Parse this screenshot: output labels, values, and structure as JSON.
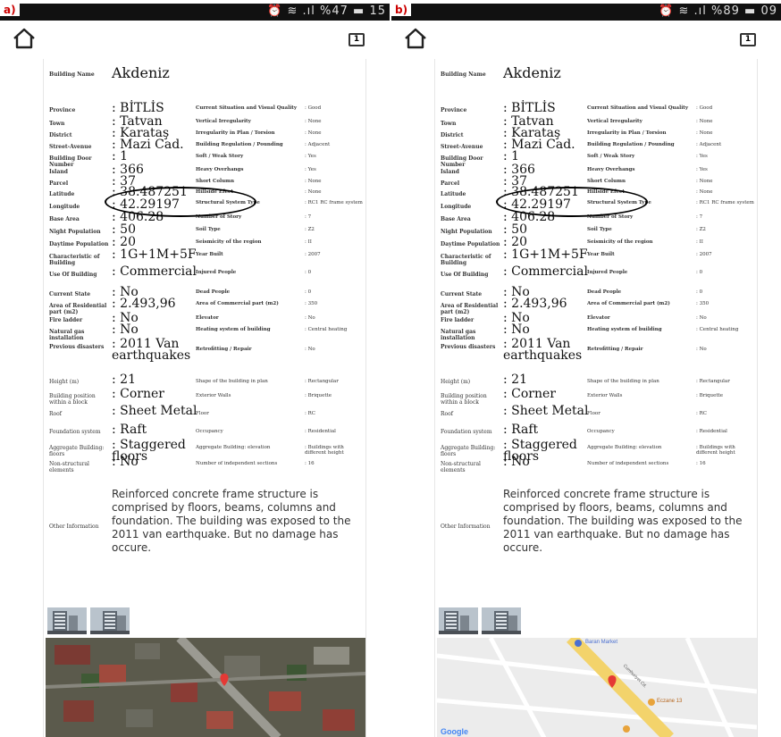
{
  "panels": [
    {
      "label": "a)",
      "status": "⏰ ≋ .ıl %47 ▬ 15",
      "tabs_count": "1",
      "building_name_label": "Building Name",
      "building_name": "Akdeniz",
      "left_rows": [
        {
          "label": "Province",
          "value": ": BİTLİS"
        },
        {
          "label": "Town",
          "value": ": Tatvan"
        },
        {
          "label": "District",
          "value": ": Karataş"
        },
        {
          "label": "Street-Avenue",
          "value": ": Mazi Cad."
        },
        {
          "label": "Building Door Number",
          "value": ": 1"
        },
        {
          "label": "Island",
          "value": ": 366"
        },
        {
          "label": "Parcel",
          "value": ": 37"
        },
        {
          "label": "Latitude",
          "value": ": 38.487251"
        },
        {
          "label": "Longitude",
          "value": ": 42.29197"
        },
        {
          "label": "Base Area",
          "value": ": 406.28"
        },
        {
          "label": "Night Population",
          "value": ": 50"
        },
        {
          "label": "Daytime Population",
          "value": ": 20"
        },
        {
          "label": "Characteristic of Building",
          "value": ": 1G+1M+5F"
        },
        {
          "label": "Use Of Building",
          "value": ": Commercial"
        },
        {
          "label": "Current State",
          "value": ": No"
        },
        {
          "label": "Area of Residential part (m2)",
          "value": ": 2.493,96"
        },
        {
          "label": "Fire ladder",
          "value": ": No"
        },
        {
          "label": "Natural gas installation",
          "value": ": No"
        },
        {
          "label": "Previous disasters",
          "value": ": 2011 Van earthquakes"
        }
      ],
      "right_rows": [
        {
          "label": "Current Situation and Visual Quality",
          "value": ": Good"
        },
        {
          "label": "Vertical Irregularity",
          "value": ": None"
        },
        {
          "label": "Irregularity in Plan / Torsion",
          "value": ": None"
        },
        {
          "label": "Building Regulation / Pounding",
          "value": ": Adjacent"
        },
        {
          "label": "Soft / Weak Story",
          "value": ": Yes"
        },
        {
          "label": "Heavy Overhangs",
          "value": ": Yes"
        },
        {
          "label": "Short Column",
          "value": ": None"
        },
        {
          "label": "Hillside Efect",
          "value": ": None"
        },
        {
          "label": "Structural System Type",
          "value": ": RC1 RC frame system"
        },
        {
          "label": "Number of Story",
          "value": ": 7"
        },
        {
          "label": "Soil Type",
          "value": ": Z2"
        },
        {
          "label": "Seismicity of the region",
          "value": ": II"
        },
        {
          "label": "Year Built",
          "value": ": 2007"
        },
        {
          "label": "Injured People",
          "value": ": 0"
        },
        {
          "label": "Dead People",
          "value": ": 0"
        },
        {
          "label": "Area of Commercial part (m2)",
          "value": ": 350"
        },
        {
          "label": "Elevator",
          "value": ": No"
        },
        {
          "label": "Heating system of building",
          "value": ": Central heating"
        },
        {
          "label": "Retrofitting / Repair",
          "value": ": No"
        }
      ],
      "lower_rows": [
        {
          "label": "Height (m)",
          "value": ": 21",
          "label2": "Shape of the building in plan",
          "value2": ": Rectangular"
        },
        {
          "label": "Building position within a block",
          "value": ": Corner",
          "label2": "Exterior Walls",
          "value2": ": Briquette"
        },
        {
          "label": "Roof",
          "value": ": Sheet Metal",
          "label2": "Floor",
          "value2": ": RC"
        },
        {
          "label": "Foundation system",
          "value": ": Raft",
          "label2": "Occupancy",
          "value2": ": Residential"
        },
        {
          "label": "Aggregate Building: floors",
          "value": ": Staggered floors",
          "label2": "Aggregate Building: elevation",
          "value2": ": Buildings with different height"
        },
        {
          "label": "Non-structural elements",
          "value": ": No",
          "label2": "Number of independent sections",
          "value2": ": 16"
        }
      ],
      "other_info_label": "Other Information",
      "other_info": "Reinforced concrete frame structure is comprised by floors, beams, columns and foundation. The building was exposed to the 2011 van earthquake. But no damage has occure.",
      "map_type": "satellite",
      "map_labels": {
        "label1": "",
        "label2": "",
        "label3": "",
        "label4": ""
      }
    },
    {
      "label": "b)",
      "status": "⏰ ≋ .ıl %89 ▬ 09",
      "tabs_count": "1",
      "building_name_label": "Building Name",
      "building_name": "Akdeniz",
      "left_rows": [
        {
          "label": "Province",
          "value": ": BİTLİS"
        },
        {
          "label": "Town",
          "value": ": Tatvan"
        },
        {
          "label": "District",
          "value": ": Karataş"
        },
        {
          "label": "Street-Avenue",
          "value": ": Mazi Cad."
        },
        {
          "label": "Building Door Number",
          "value": ": 1"
        },
        {
          "label": "Island",
          "value": ": 366"
        },
        {
          "label": "Parcel",
          "value": ": 37"
        },
        {
          "label": "Latitude",
          "value": ": 38.487251"
        },
        {
          "label": "Longitude",
          "value": ": 42.29197"
        },
        {
          "label": "Base Area",
          "value": ": 406.28"
        },
        {
          "label": "Night Population",
          "value": ": 50"
        },
        {
          "label": "Daytime Population",
          "value": ": 20"
        },
        {
          "label": "Characteristic of Building",
          "value": ": 1G+1M+5F"
        },
        {
          "label": "Use Of Building",
          "value": ": Commercial"
        },
        {
          "label": "Current State",
          "value": ": No"
        },
        {
          "label": "Area of Residential part (m2)",
          "value": ": 2.493,96"
        },
        {
          "label": "Fire ladder",
          "value": ": No"
        },
        {
          "label": "Natural gas installation",
          "value": ": No"
        },
        {
          "label": "Previous disasters",
          "value": ": 2011 Van earthquakes"
        }
      ],
      "right_rows": [
        {
          "label": "Current Situation and Visual Quality",
          "value": ": Good"
        },
        {
          "label": "Vertical Irregularity",
          "value": ": None"
        },
        {
          "label": "Irregularity in Plan / Torsion",
          "value": ": None"
        },
        {
          "label": "Building Regulation / Pounding",
          "value": ": Adjacent"
        },
        {
          "label": "Soft / Weak Story",
          "value": ": Yes"
        },
        {
          "label": "Heavy Overhangs",
          "value": ": Yes"
        },
        {
          "label": "Short Column",
          "value": ": None"
        },
        {
          "label": "Hillside Efect",
          "value": ": None"
        },
        {
          "label": "Structural System Type",
          "value": ": RC1 RC frame system"
        },
        {
          "label": "Number of Story",
          "value": ": 7"
        },
        {
          "label": "Soil Type",
          "value": ": Z2"
        },
        {
          "label": "Seismicity of the region",
          "value": ": II"
        },
        {
          "label": "Year Built",
          "value": ": 2007"
        },
        {
          "label": "Injured People",
          "value": ": 0"
        },
        {
          "label": "Dead People",
          "value": ": 0"
        },
        {
          "label": "Area of Commercial part (m2)",
          "value": ": 350"
        },
        {
          "label": "Elevator",
          "value": ": No"
        },
        {
          "label": "Heating system of building",
          "value": ": Central heating"
        },
        {
          "label": "Retrofitting / Repair",
          "value": ": No"
        }
      ],
      "lower_rows": [
        {
          "label": "Height (m)",
          "value": ": 21",
          "label2": "Shape of the building in plan",
          "value2": ": Rectangular"
        },
        {
          "label": "Building position within a block",
          "value": ": Corner",
          "label2": "Exterior Walls",
          "value2": ": Briquette"
        },
        {
          "label": "Roof",
          "value": ": Sheet Metal",
          "label2": "Floor",
          "value2": ": RC"
        },
        {
          "label": "Foundation system",
          "value": ": Raft",
          "label2": "Occupancy",
          "value2": ": Residential"
        },
        {
          "label": "Aggregate Building: floors",
          "value": ": Staggered floors",
          "label2": "Aggregate Building: elevation",
          "value2": ": Buildings with different height"
        },
        {
          "label": "Non-structural elements",
          "value": ": No",
          "label2": "Number of independent sections",
          "value2": ": 16"
        }
      ],
      "other_info_label": "Other Information",
      "other_info": "Reinforced concrete frame structure is comprised by floors, beams, columns and foundation. The building was exposed to the 2011 van earthquake. But no damage has occure.",
      "map_type": "roadmap",
      "map_labels": {
        "label1": "Baran Market",
        "label2": "Eczane 13",
        "label3": "Cumhuriyet Cd.",
        "label4": "Google"
      }
    }
  ],
  "colors": {
    "statusbar": "#111111",
    "panel_label": "#cc0000",
    "map_road": "#f3d36b",
    "pin": "#e53935"
  }
}
